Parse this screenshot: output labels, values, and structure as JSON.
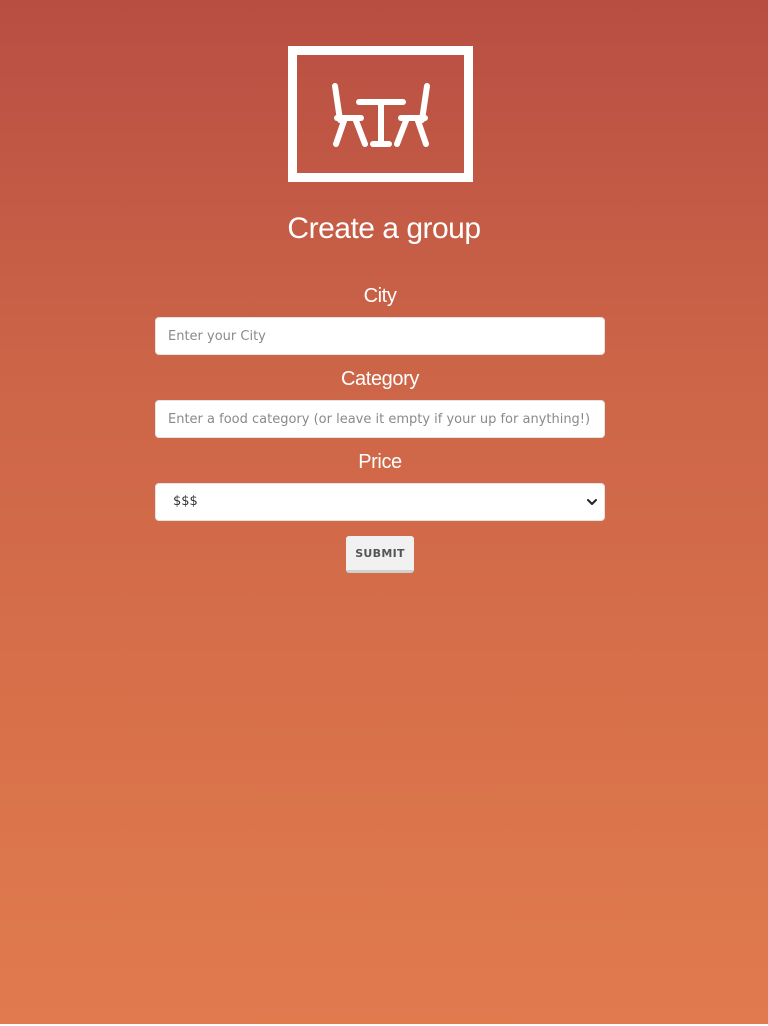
{
  "logo": {
    "icon": "table-and-chairs-icon"
  },
  "page": {
    "title": "Create a group"
  },
  "form": {
    "city": {
      "label": "City",
      "placeholder": "Enter your City",
      "value": ""
    },
    "category": {
      "label": "Category",
      "placeholder": "Enter a food category (or leave it empty if your up for anything!)",
      "value": ""
    },
    "price": {
      "label": "Price",
      "selected": "$$$"
    },
    "submit_label": "SUBMIT"
  },
  "colors": {
    "background_top": "#b84e42",
    "background_bottom": "#e17b4e",
    "text": "#ffffff",
    "button_bg": "#f1f1f1",
    "button_text": "#555555"
  }
}
